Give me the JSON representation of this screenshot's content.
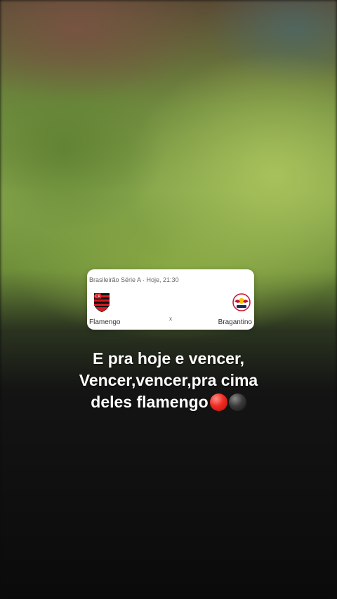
{
  "match_card": {
    "header": "Brasileirão Série A · Hoje, 21:30",
    "home_team": "Flamengo",
    "away_team": "Bragantino",
    "separator": "x",
    "home_crest_icon": "flamengo-crest-icon",
    "away_crest_icon": "red-bull-bragantino-crest-icon"
  },
  "caption": {
    "line1": "E pra hoje e vencer,",
    "line2": "Vencer,vencer,pra cima",
    "line3": "deles flamengo",
    "emojis": [
      "red-circle-emoji",
      "black-circle-emoji"
    ]
  },
  "colors": {
    "flamengo_red": "#d71920",
    "flamengo_black": "#111111",
    "caption_text": "#ffffff"
  }
}
